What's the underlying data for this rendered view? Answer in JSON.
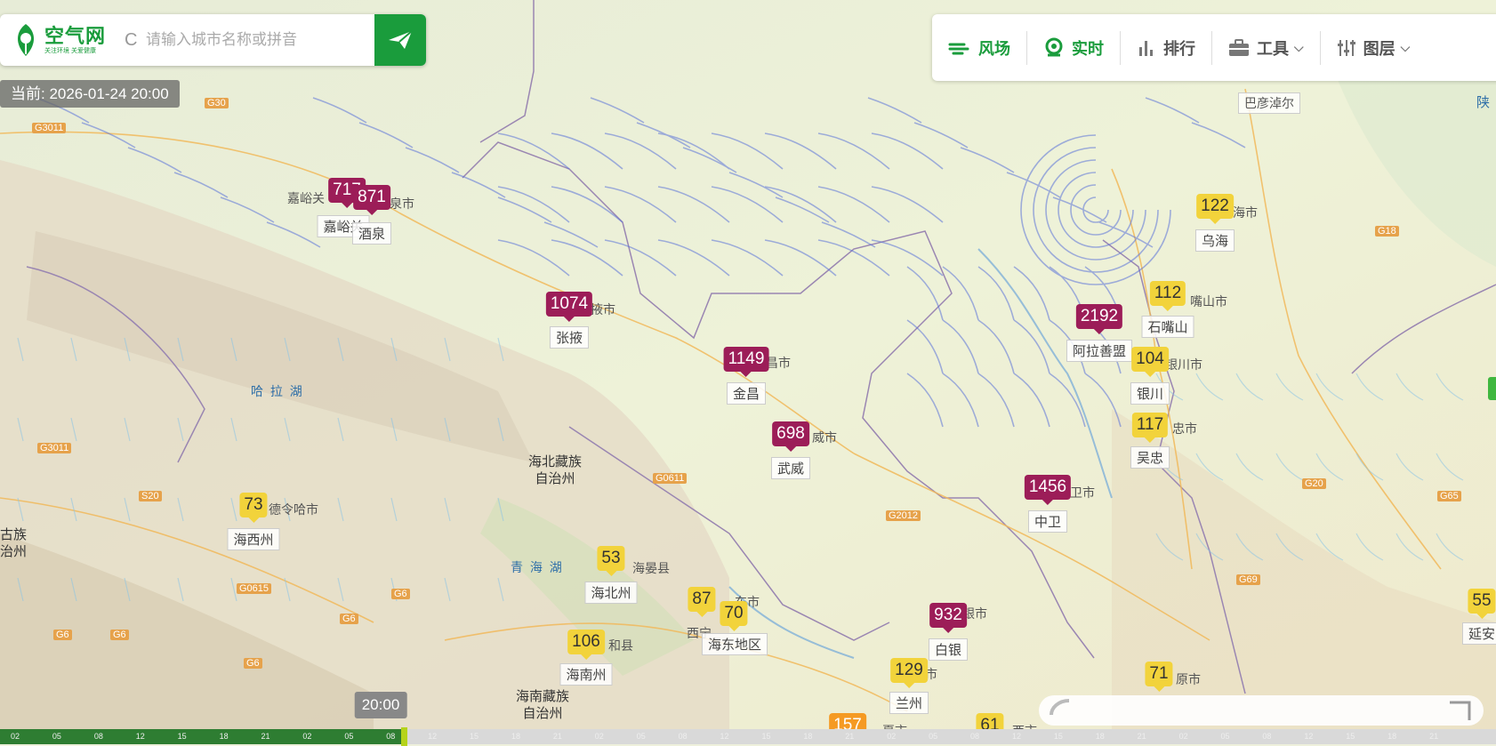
{
  "search": {
    "placeholder": "请输入城市名称或拼音",
    "refresh_glyph": "C"
  },
  "logo": {
    "title": "空气网",
    "subtitle": "关注环境 关爱健康"
  },
  "current_time": "当前: 2026-01-24 20:00",
  "toolbar": {
    "wind": "风场",
    "realtime": "实时",
    "rank": "排行",
    "tools": "工具",
    "layers": "图层",
    "chevron": "⌵",
    "active_color": "#1a9c3c"
  },
  "markers": [
    {
      "id": "jiayuguan",
      "value": "717",
      "level": "p"
    },
    {
      "id": "jiuquan",
      "value": "871",
      "level": "p"
    },
    {
      "id": "zhangye",
      "value": "1074",
      "level": "p"
    },
    {
      "id": "jinchang",
      "value": "1149",
      "level": "p"
    },
    {
      "id": "wuwei",
      "value": "698",
      "level": "p"
    },
    {
      "id": "alashan",
      "value": "2192",
      "level": "p"
    },
    {
      "id": "zhongwei",
      "value": "1456",
      "level": "p"
    },
    {
      "id": "baiyin",
      "value": "932",
      "level": "p"
    },
    {
      "id": "wuhai",
      "value": "122",
      "level": "y"
    },
    {
      "id": "shizuishan",
      "value": "112",
      "level": "y"
    },
    {
      "id": "yinchuan",
      "value": "104",
      "level": "y"
    },
    {
      "id": "wuzhong",
      "value": "117",
      "level": "y"
    },
    {
      "id": "haixi",
      "value": "73",
      "level": "y"
    },
    {
      "id": "haibei",
      "value": "53",
      "level": "y"
    },
    {
      "id": "xining",
      "value": "87",
      "level": "y"
    },
    {
      "id": "haidong",
      "value": "70",
      "level": "y"
    },
    {
      "id": "hainan",
      "value": "106",
      "level": "y"
    },
    {
      "id": "lanzhou",
      "value": "129",
      "level": "y"
    },
    {
      "id": "guyuan",
      "value": "71",
      "level": "y"
    },
    {
      "id": "yanan",
      "value": "55",
      "level": "y"
    },
    {
      "id": "dingxi",
      "value": "157",
      "level": "o"
    },
    {
      "id": "pingliang",
      "value": "61",
      "level": "y"
    }
  ],
  "city_labels": {
    "jiayuguan": "嘉峪关",
    "jiuquan": "酒泉",
    "zhangye": "张掖",
    "jinchang": "金昌",
    "wuwei": "武威",
    "alashan": "阿拉善盟",
    "zhongwei": "中卫",
    "baiyin": "白银",
    "wuhai": "乌海",
    "shizuishan": "石嘴山",
    "yinchuan": "银川",
    "wuzhong": "吴忠",
    "haixi": "海西州",
    "haibei": "海北州",
    "haidong": "海东地区",
    "hainan": "海南州",
    "lanzhou": "兰州",
    "yanan": "延安"
  },
  "map_texts": {
    "bayanhaote": "巴彦淖尔",
    "jiayuguan_top": "嘉峪关",
    "jiuquan_suffix": "泉市",
    "zhangye_suffix": "掖市",
    "jinchang_suffix": "昌市",
    "wuwei_suffix": "威市",
    "zhongwei_suffix": "卫市",
    "wuhai_suffix": "海市",
    "shizuishan_suffix": "嘴山市",
    "yinchuan_suffix": "银川市",
    "wuzhong_suffix": "忠市",
    "baiyin_suffix": "银市",
    "lanzhou_suffix": "兰州市",
    "guyuan_suffix": "原市",
    "haixi_suffix": "德令哈市",
    "haibei_suffix": "海晏县",
    "hainan_suffix": "和县",
    "xining": "西宁",
    "haidong_suffix": "东市",
    "dingxi_suffix": "夏市",
    "pingliang_suffix": "西市",
    "lake_hala": "哈 拉 湖",
    "lake_qinghai": "青 海 湖",
    "haibei_region": "海北藏族\n自治州",
    "hainan_region": "海南藏族\n自治州",
    "left_region": "古族\n治州",
    "shanxi": "陕",
    "alashan_partial": "阿拉善盟"
  },
  "roads": [
    "G30",
    "G3011",
    "G3011",
    "S20",
    "G6",
    "G6",
    "G6",
    "G6",
    "G0611",
    "G2012",
    "G18",
    "G20",
    "G65",
    "G69",
    "G0615",
    "G6"
  ],
  "timeline": {
    "tooltip": "20:00",
    "progress": 0.27,
    "ticks": [
      "02",
      "05",
      "08",
      "12",
      "15",
      "18",
      "21",
      "02",
      "05",
      "08",
      "12",
      "15",
      "18",
      "21",
      "02",
      "05",
      "08",
      "12",
      "15",
      "18",
      "21",
      "02",
      "05",
      "08",
      "12",
      "15",
      "18",
      "21",
      "02",
      "05",
      "08",
      "12",
      "15",
      "18",
      "21"
    ]
  },
  "colors": {
    "brand": "#1a9c3c",
    "poor": "#9c1d58",
    "moderate": "#f2d33b",
    "unhealthy": "#f59a23"
  }
}
